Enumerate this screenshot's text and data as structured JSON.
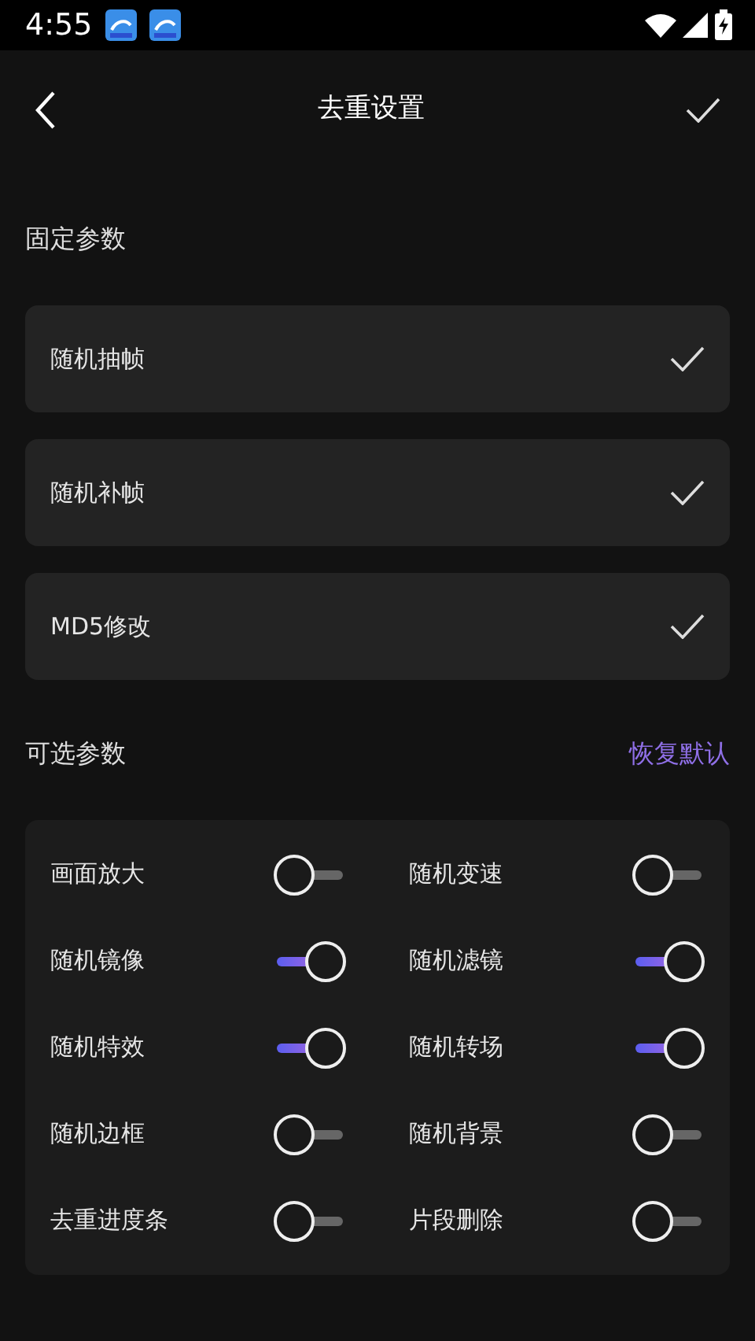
{
  "status_bar": {
    "time": "4:55",
    "notifications": [
      {
        "kind": "app"
      },
      {
        "kind": "app"
      }
    ]
  },
  "header": {
    "title": "去重设置"
  },
  "fixed_section": {
    "title": "固定参数",
    "items": [
      {
        "label": "随机抽帧",
        "checked": true
      },
      {
        "label": "随机补帧",
        "checked": true
      },
      {
        "label": "MD5修改",
        "checked": true
      }
    ]
  },
  "optional_section": {
    "title": "可选参数",
    "reset_link": "恢复默认",
    "toggles": [
      {
        "label": "画面放大",
        "on": false
      },
      {
        "label": "随机变速",
        "on": false
      },
      {
        "label": "随机镜像",
        "on": true
      },
      {
        "label": "随机滤镜",
        "on": true
      },
      {
        "label": "随机特效",
        "on": true
      },
      {
        "label": "随机转场",
        "on": true
      },
      {
        "label": "随机边框",
        "on": false
      },
      {
        "label": "随机背景",
        "on": false
      },
      {
        "label": "去重进度条",
        "on": false
      },
      {
        "label": "片段删除",
        "on": false
      }
    ]
  }
}
